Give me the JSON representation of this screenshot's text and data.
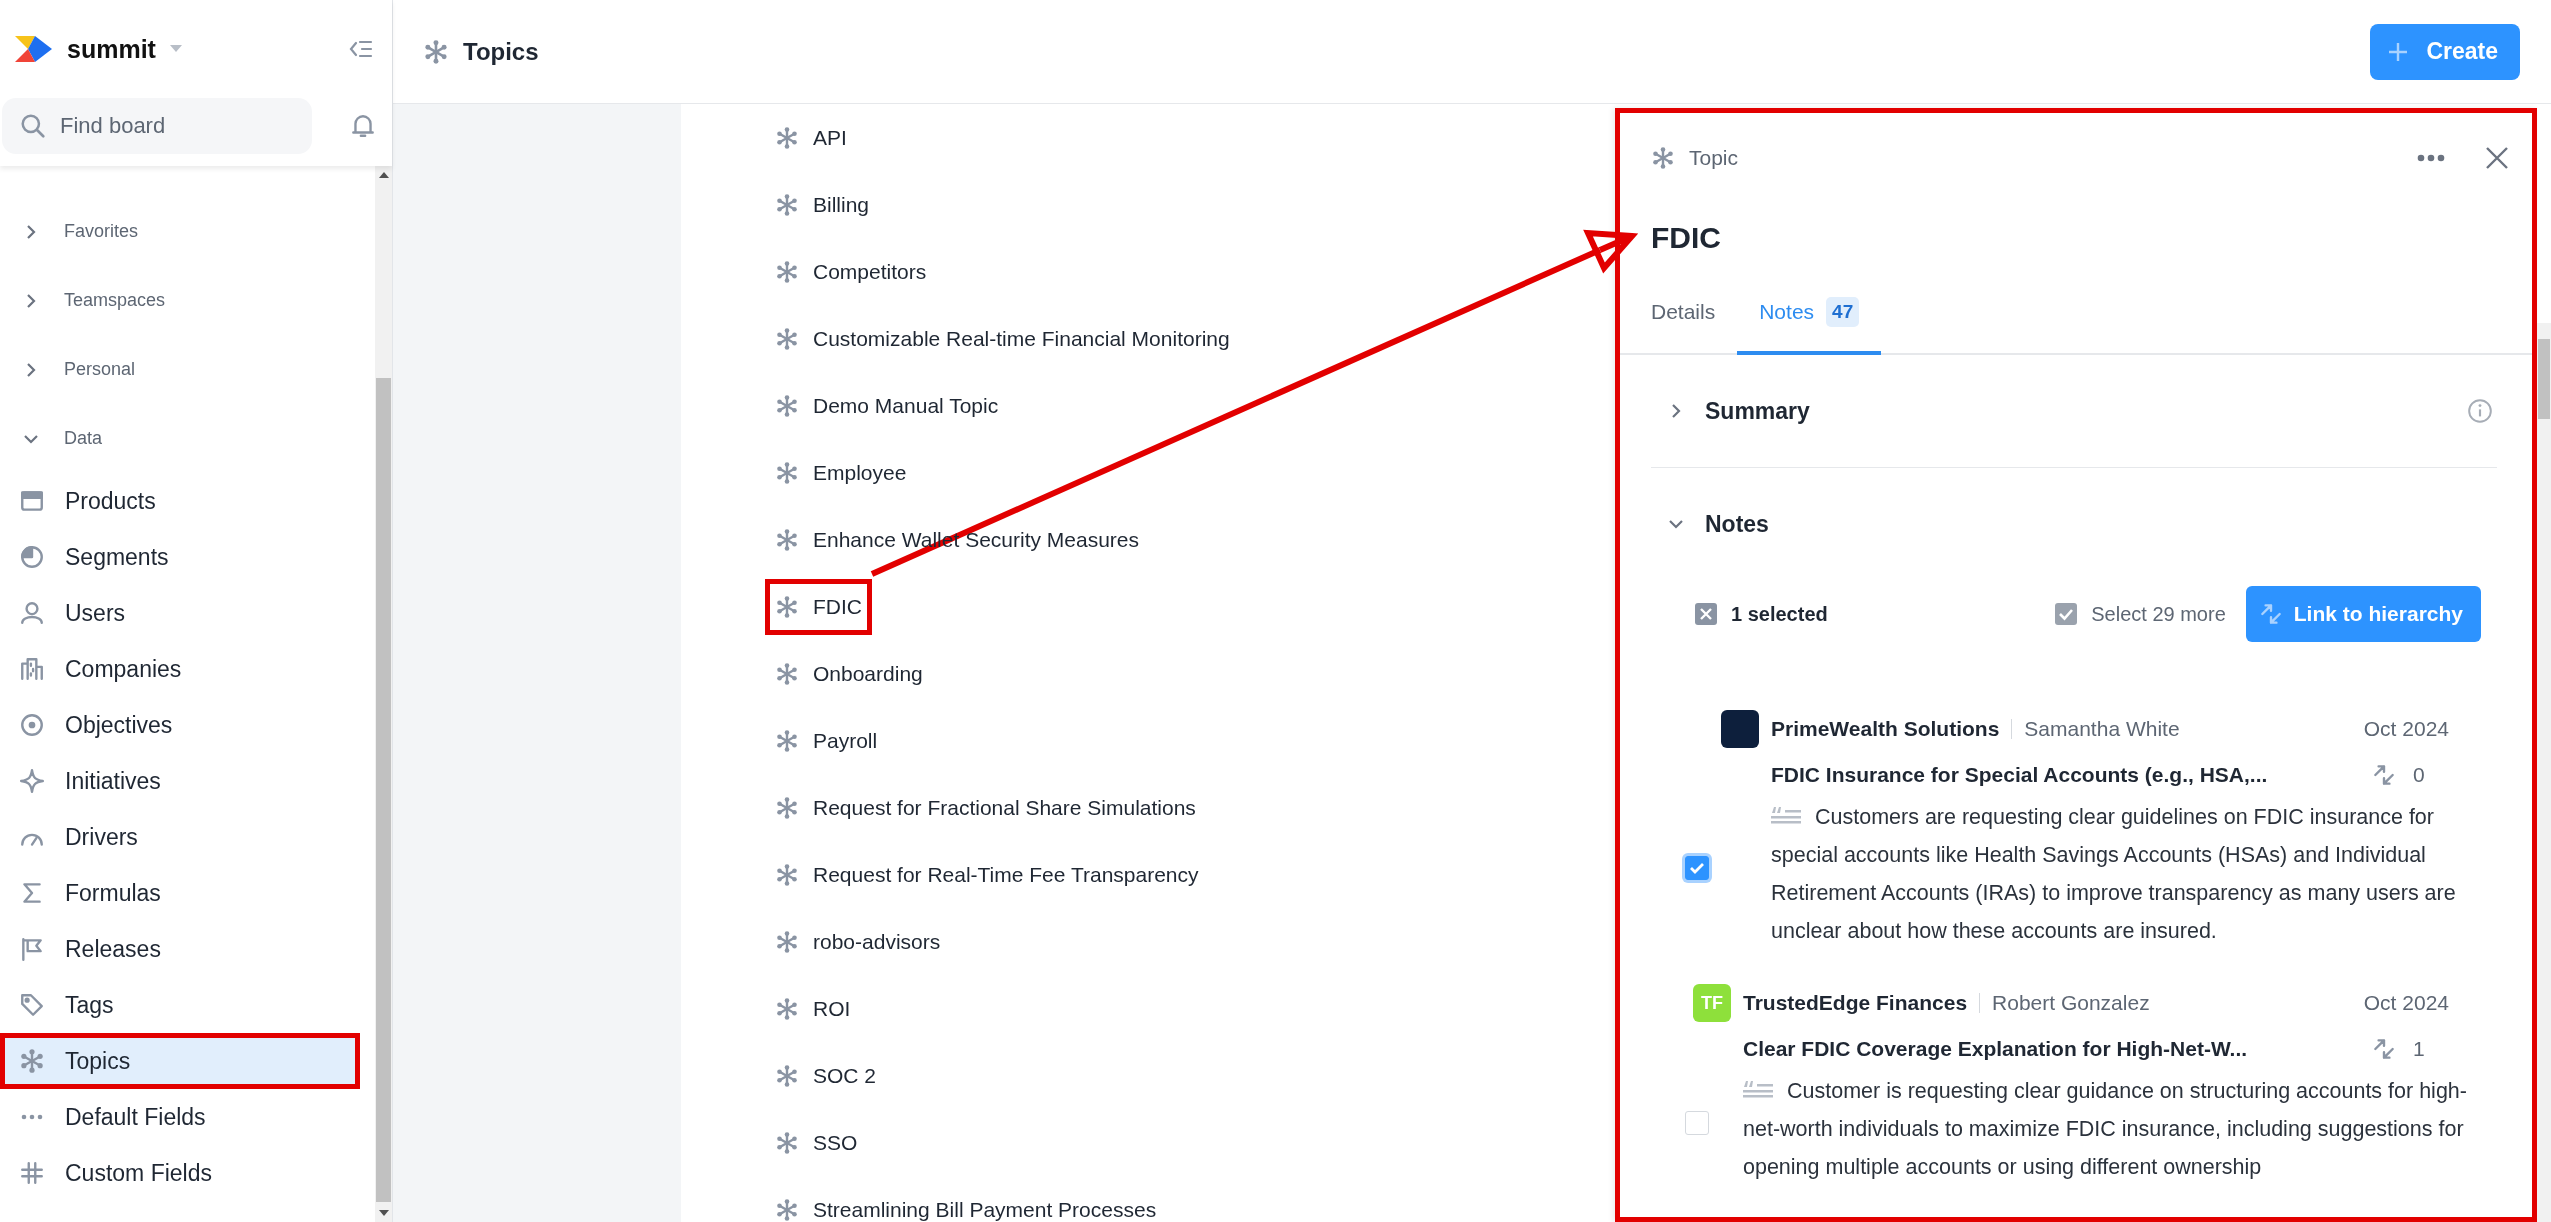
{
  "workspace": {
    "name": "summit"
  },
  "search": {
    "placeholder": "Find board"
  },
  "sidebar": {
    "items": [
      {
        "kind": "section",
        "label": "Favorites",
        "expanded": false
      },
      {
        "kind": "section",
        "label": "Teamspaces",
        "expanded": false
      },
      {
        "kind": "section",
        "label": "Personal",
        "expanded": false
      },
      {
        "kind": "section",
        "label": "Data",
        "expanded": true
      },
      {
        "kind": "item",
        "label": "Products",
        "selected": false,
        "annotated": false
      },
      {
        "kind": "item",
        "label": "Segments",
        "selected": false,
        "annotated": false
      },
      {
        "kind": "item",
        "label": "Users",
        "selected": false,
        "annotated": false
      },
      {
        "kind": "item",
        "label": "Companies",
        "selected": false,
        "annotated": false
      },
      {
        "kind": "item",
        "label": "Objectives",
        "selected": false,
        "annotated": false
      },
      {
        "kind": "item",
        "label": "Initiatives",
        "selected": false,
        "annotated": false
      },
      {
        "kind": "item",
        "label": "Drivers",
        "selected": false,
        "annotated": false
      },
      {
        "kind": "item",
        "label": "Formulas",
        "selected": false,
        "annotated": false
      },
      {
        "kind": "item",
        "label": "Releases",
        "selected": false,
        "annotated": false
      },
      {
        "kind": "item",
        "label": "Tags",
        "selected": false,
        "annotated": false
      },
      {
        "kind": "item",
        "label": "Topics",
        "selected": true,
        "annotated": true
      },
      {
        "kind": "item",
        "label": "Default Fields",
        "selected": false,
        "annotated": false
      },
      {
        "kind": "item",
        "label": "Custom Fields",
        "selected": false,
        "annotated": false
      }
    ]
  },
  "header": {
    "title": "Topics",
    "create_button": "Create"
  },
  "topics": [
    {
      "label": "API",
      "annotated": false
    },
    {
      "label": "Billing",
      "annotated": false
    },
    {
      "label": "Competitors",
      "annotated": false
    },
    {
      "label": "Customizable Real-time Financial Monitoring",
      "annotated": false
    },
    {
      "label": "Demo Manual Topic",
      "annotated": false
    },
    {
      "label": "Employee",
      "annotated": false
    },
    {
      "label": "Enhance Wallet Security Measures",
      "annotated": false
    },
    {
      "label": "FDIC",
      "annotated": true
    },
    {
      "label": "Onboarding",
      "annotated": false
    },
    {
      "label": "Payroll",
      "annotated": false
    },
    {
      "label": "Request for Fractional Share Simulations",
      "annotated": false
    },
    {
      "label": "Request for Real-Time Fee Transparency",
      "annotated": false
    },
    {
      "label": "robo-advisors",
      "annotated": false
    },
    {
      "label": "ROI",
      "annotated": false
    },
    {
      "label": "SOC 2",
      "annotated": false
    },
    {
      "label": "SSO",
      "annotated": false
    },
    {
      "label": "Streamlining Bill Payment Processes",
      "annotated": false
    }
  ],
  "annotation_arrow": true,
  "panel": {
    "type_label": "Topic",
    "title": "FDIC",
    "annotated": true,
    "tabs": [
      {
        "label": "Details",
        "selected": false
      },
      {
        "label": "Notes",
        "count": "47",
        "selected": true
      }
    ],
    "summary": {
      "title": "Summary",
      "expanded": false
    },
    "notes_section": {
      "title": "Notes",
      "expanded": true
    },
    "selection": {
      "count_label": "1 selected",
      "select_more": "Select 29 more",
      "link_button": "Link to hierarchy"
    },
    "notes": [
      {
        "kind": "logo",
        "color": "#0d1f3c",
        "company": "PrimeWealth Solutions",
        "contact": "Samantha White",
        "date": "Oct 2024",
        "title": "FDIC Insurance for Special Accounts (e.g., HSA,...",
        "links": "0",
        "selected": true,
        "body": "Customers are requesting clear guidelines on FDIC insurance for special accounts like Health Savings Accounts (HSAs) and Individual Retirement Accounts (IRAs) to improve transparency as many users are unclear about how these accounts are insured."
      },
      {
        "kind": "initials",
        "avatar_text": "TF",
        "color": "#8ee03b",
        "company": "TrustedEdge Finances",
        "contact": "Robert Gonzalez",
        "date": "Oct 2024",
        "title": "Clear FDIC Coverage Explanation for High-Net-W...",
        "links": "1",
        "selected": false,
        "body": "Customer is requesting clear guidance on structuring accounts for high-net-worth individuals to maximize FDIC insurance, including suggestions for opening multiple accounts or using different ownership"
      }
    ]
  }
}
